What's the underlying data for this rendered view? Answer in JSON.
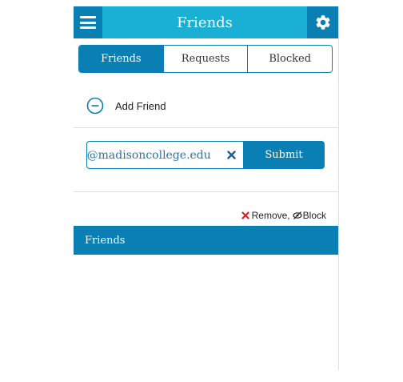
{
  "header": {
    "title": "Friends",
    "menu_icon": "hamburger-icon",
    "settings_icon": "gear-icon"
  },
  "tabs": [
    {
      "label": "Friends",
      "active": true
    },
    {
      "label": "Requests",
      "active": false
    },
    {
      "label": "Blocked",
      "active": false
    }
  ],
  "add_friend": {
    "label": "Add Friend",
    "icon": "minus-circle-icon"
  },
  "email_input": {
    "value": "t@madisoncollege.edu",
    "clear_icon": "close-icon"
  },
  "submit_label": "Submit",
  "legend": {
    "remove_label": "Remove,",
    "block_label": "Block"
  },
  "friends_section": {
    "title": "Friends"
  },
  "colors": {
    "header_bg": "#1ab0d6",
    "primary": "#0a7fb3",
    "remove_red": "#e02020"
  }
}
